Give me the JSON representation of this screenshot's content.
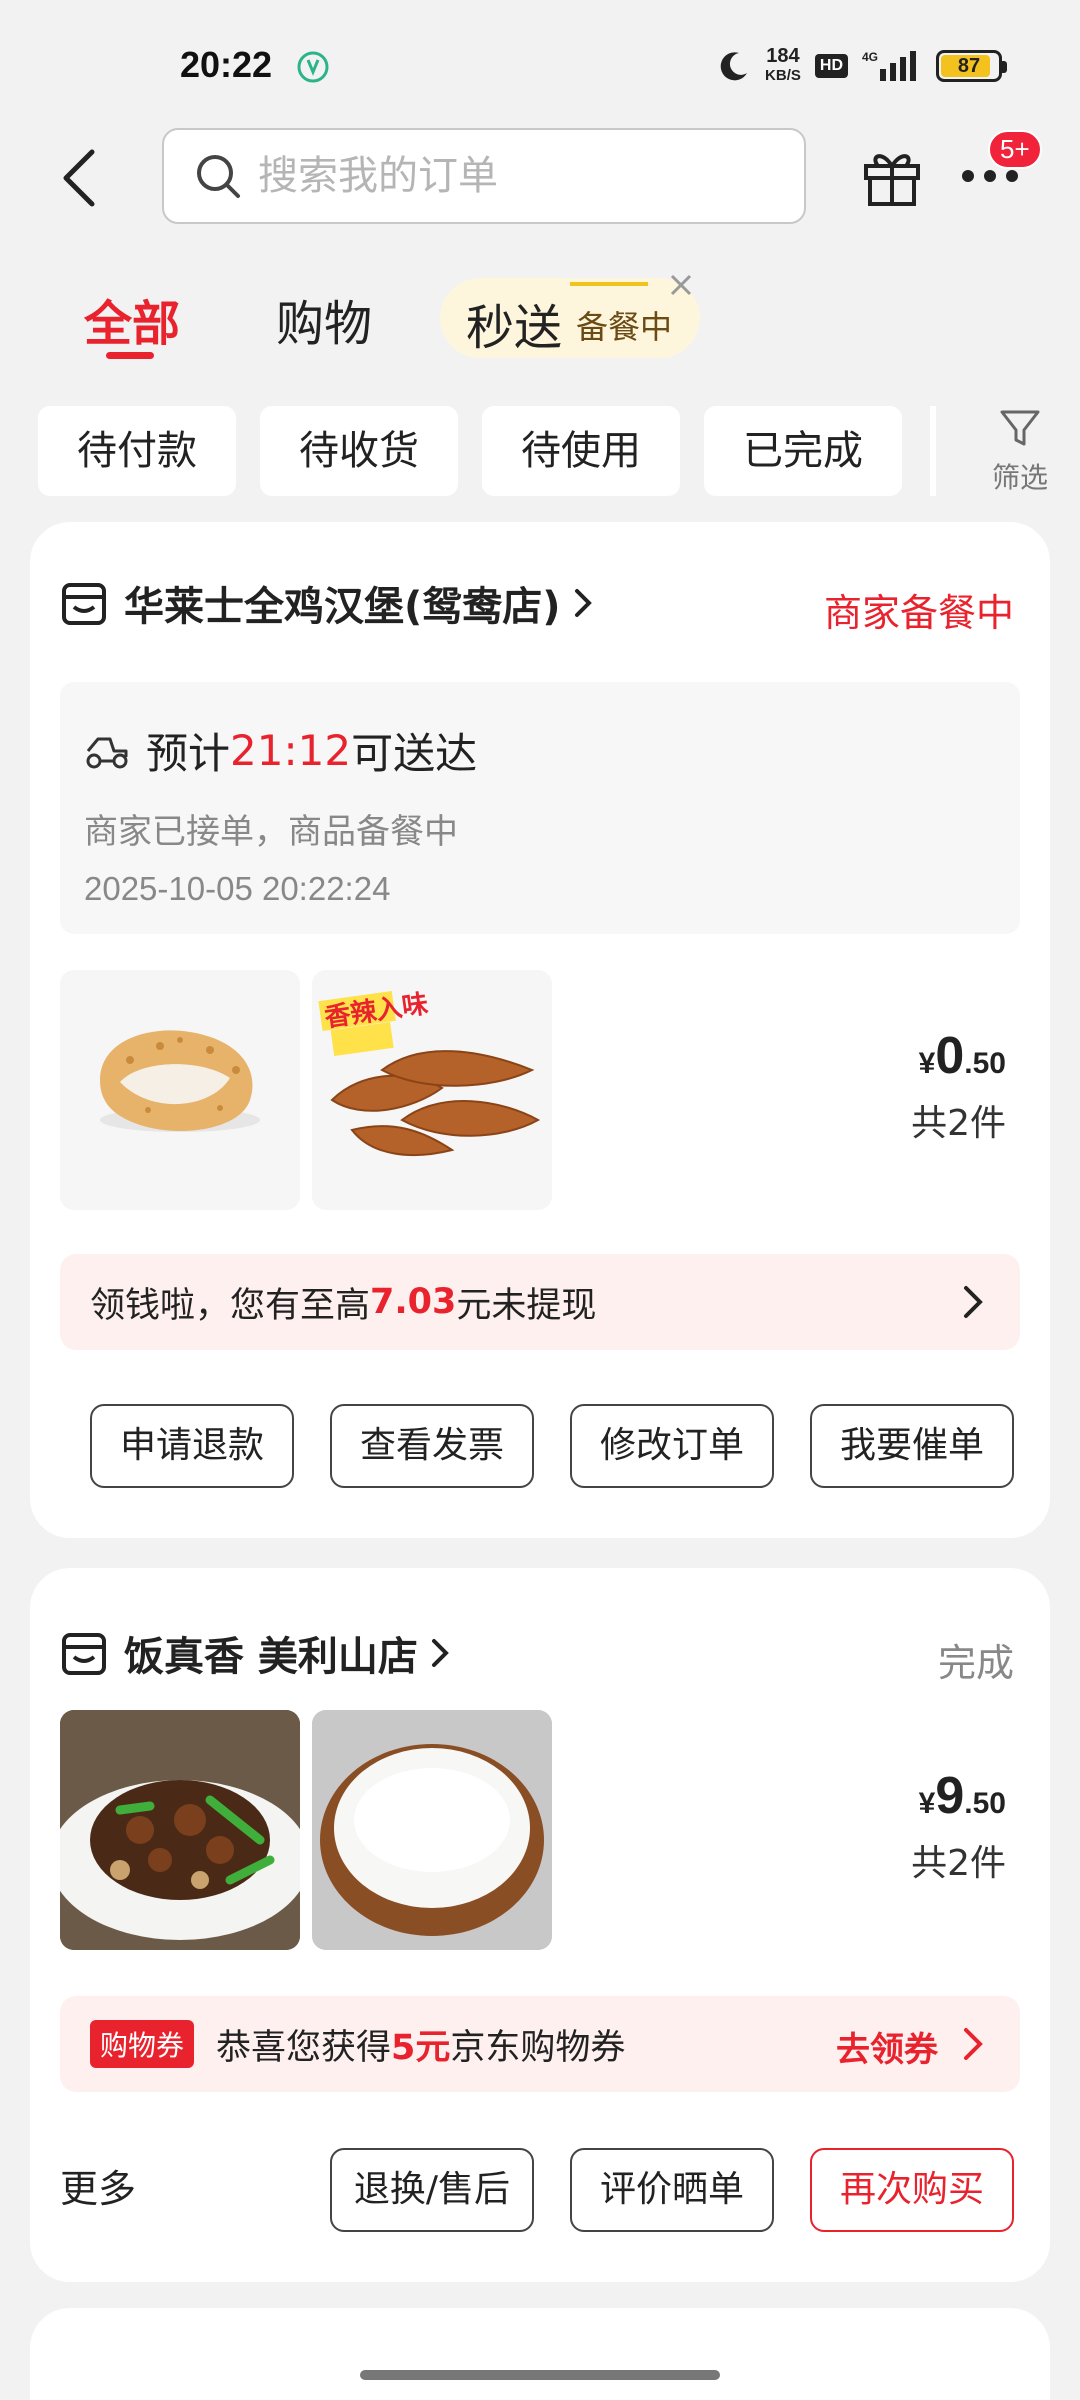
{
  "status_bar": {
    "time": "20:22",
    "net_speed": "184",
    "net_unit": "KB/S",
    "hd": "HD",
    "signal": "4G",
    "battery": "87"
  },
  "header": {
    "search_placeholder": "搜索我的订单",
    "badge": "5+"
  },
  "tabs": {
    "all": "全部",
    "shopping": "购物",
    "flash": "秒送",
    "flash_sub": "备餐中"
  },
  "filters": {
    "chips": [
      "待付款",
      "待收货",
      "待使用",
      "已完成"
    ],
    "filter_label": "筛选"
  },
  "orders": [
    {
      "store": "华莱士全鸡汉堡(鸳鸯店)",
      "status": "商家备餐中",
      "eta_prefix": "预计",
      "eta_time": "21:12",
      "eta_suffix": "可送达",
      "progress": "商家已接单，商品备餐中",
      "timestamp": "2025-10-05 20:22:24",
      "price_symbol": "¥",
      "price_int": "0",
      "price_dec": ".50",
      "count": "共2件",
      "banner_pre": "领钱啦，您有至高",
      "banner_amount": "7.03",
      "banner_post": "元未提现",
      "product_overlay": "香辣入味",
      "buttons": [
        "申请退款",
        "查看发票",
        "修改订单",
        "我要催单"
      ]
    },
    {
      "store": "饭真香 美利山店",
      "status": "完成",
      "price_symbol": "¥",
      "price_int": "9",
      "price_dec": ".50",
      "count": "共2件",
      "coupon_tag": "购物券",
      "banner_pre": "恭喜您获得",
      "banner_amount": "5元",
      "banner_post": "京东购物券",
      "banner_action": "去领券",
      "more": "更多",
      "buttons": [
        "退换/售后",
        "评价晒单",
        "再次购买"
      ]
    }
  ],
  "colors": {
    "accent": "#e8232e",
    "flash_bg": "#fdf6dd",
    "banner_bg": "#fff0f0"
  }
}
